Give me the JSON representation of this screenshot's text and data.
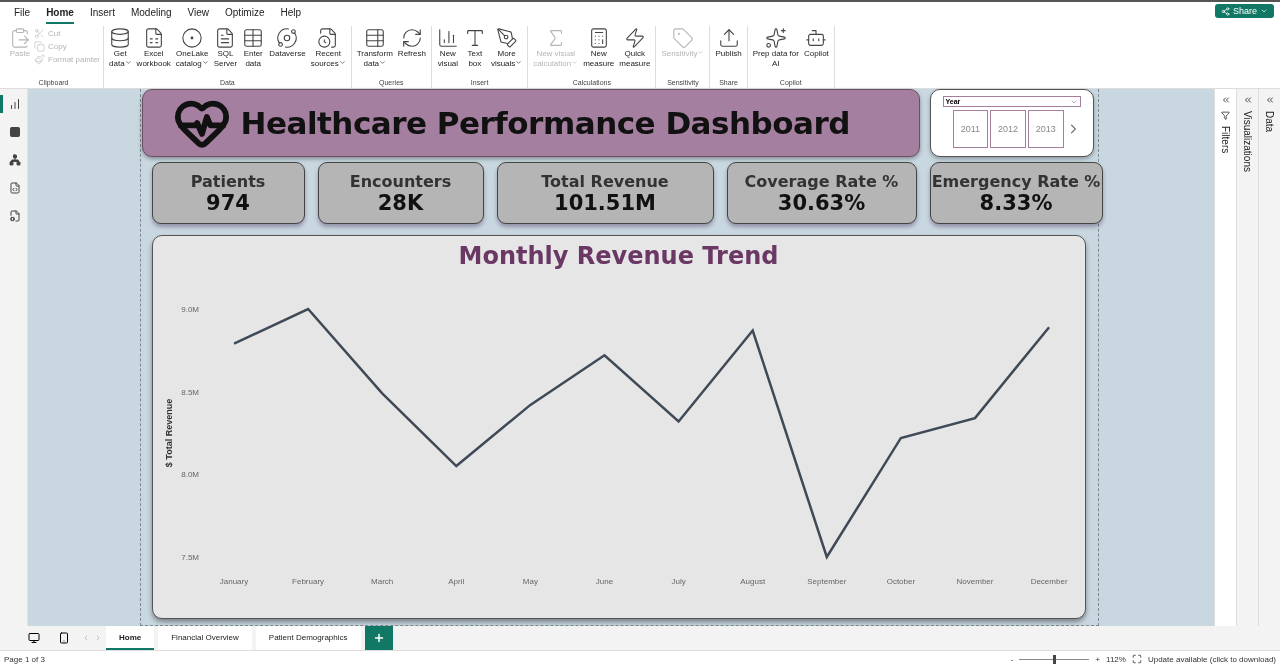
{
  "menu": [
    {
      "label": "File",
      "selected": false
    },
    {
      "label": "Home",
      "selected": true
    },
    {
      "label": "Insert",
      "selected": false
    },
    {
      "label": "Modeling",
      "selected": false
    },
    {
      "label": "View",
      "selected": false
    },
    {
      "label": "Optimize",
      "selected": false
    },
    {
      "label": "Help",
      "selected": false
    }
  ],
  "share_button": {
    "label": "Share"
  },
  "ribbon": {
    "groups": [
      {
        "name": "Clipboard",
        "items": [
          {
            "label": "Paste",
            "kind": "large",
            "disabled": true,
            "dropdown": false
          },
          {
            "label": "Cut",
            "kind": "small",
            "disabled": true
          },
          {
            "label": "Copy",
            "kind": "small",
            "disabled": true
          },
          {
            "label": "Format painter",
            "kind": "small",
            "disabled": true
          }
        ]
      },
      {
        "name": "Data",
        "items": [
          {
            "label": "Get\ndata",
            "kind": "large",
            "disabled": false,
            "dropdown": true
          },
          {
            "label": "Excel\nworkbook",
            "kind": "large",
            "disabled": false,
            "dropdown": false
          },
          {
            "label": "OneLake\ncatalog",
            "kind": "large",
            "disabled": false,
            "dropdown": true
          },
          {
            "label": "SQL\nServer",
            "kind": "large",
            "disabled": false,
            "dropdown": false
          },
          {
            "label": "Enter\ndata",
            "kind": "large",
            "disabled": false,
            "dropdown": false
          },
          {
            "label": "Dataverse",
            "kind": "large",
            "disabled": false,
            "dropdown": false
          },
          {
            "label": "Recent\nsources",
            "kind": "large",
            "disabled": false,
            "dropdown": true
          }
        ]
      },
      {
        "name": "Queries",
        "items": [
          {
            "label": "Transform\ndata",
            "kind": "large",
            "disabled": false,
            "dropdown": true
          },
          {
            "label": "Refresh",
            "kind": "large",
            "disabled": false,
            "dropdown": false
          }
        ]
      },
      {
        "name": "Insert",
        "items": [
          {
            "label": "New\nvisual",
            "kind": "large",
            "disabled": false,
            "dropdown": false
          },
          {
            "label": "Text\nbox",
            "kind": "large",
            "disabled": false,
            "dropdown": false
          },
          {
            "label": "More\nvisuals",
            "kind": "large",
            "disabled": false,
            "dropdown": true
          }
        ]
      },
      {
        "name": "Calculations",
        "items": [
          {
            "label": "New visual\ncalculation",
            "kind": "large",
            "disabled": true,
            "dropdown": true
          },
          {
            "label": "New\nmeasure",
            "kind": "large",
            "disabled": false,
            "dropdown": false
          },
          {
            "label": "Quick\nmeasure",
            "kind": "large",
            "disabled": false,
            "dropdown": false
          }
        ]
      },
      {
        "name": "Sensitivity",
        "items": [
          {
            "label": "Sensitivity",
            "kind": "large",
            "disabled": true,
            "dropdown": true
          }
        ]
      },
      {
        "name": "Share",
        "items": [
          {
            "label": "Publish",
            "kind": "large",
            "disabled": false,
            "dropdown": false
          }
        ]
      },
      {
        "name": "Copilot",
        "items": [
          {
            "label": "Prep data for\nAI",
            "kind": "large",
            "disabled": false,
            "dropdown": false
          },
          {
            "label": "Copilot",
            "kind": "large",
            "disabled": false,
            "dropdown": false
          }
        ]
      }
    ]
  },
  "views": [
    {
      "selected": true
    },
    {
      "selected": false
    },
    {
      "selected": false
    },
    {
      "selected": false
    },
    {
      "selected": false
    }
  ],
  "panes": [
    {
      "label": "Filters",
      "selected": true
    },
    {
      "label": "Visualizations",
      "selected": false
    },
    {
      "label": "Data",
      "selected": false
    }
  ],
  "dashboard": {
    "title": "Healthcare Performance Dashboard",
    "slicer": {
      "title": "Year",
      "tiles": [
        {
          "label": "2011",
          "selected": false
        },
        {
          "label": "2012",
          "selected": false
        },
        {
          "label": "2013",
          "selected": false
        }
      ]
    },
    "kpis": [
      {
        "label": "Patients",
        "value": "974"
      },
      {
        "label": "Encounters",
        "value": "28K"
      },
      {
        "label": "Total Revenue",
        "value": "101.51M"
      },
      {
        "label": "Coverage Rate %",
        "value": "30.63%"
      },
      {
        "label": "Emergency Rate %",
        "value": "8.33%"
      }
    ],
    "chart_data": {
      "type": "line",
      "title": "Monthly Revenue Trend",
      "ylabel": "$ Total Revenue",
      "categories": [
        "January",
        "February",
        "March",
        "April",
        "May",
        "June",
        "July",
        "August",
        "September",
        "October",
        "November",
        "December"
      ],
      "series": [
        {
          "color": "#3f4a56",
          "values": [
            8.79,
            9.0,
            8.49,
            8.05,
            8.42,
            8.72,
            8.32,
            8.87,
            7.5,
            8.22,
            8.34,
            8.89
          ]
        }
      ],
      "ylim": [
        7.5,
        9.0
      ],
      "yticks": [
        {
          "value": 7.5,
          "label": "7.5M"
        },
        {
          "value": 8.0,
          "label": "8.0M"
        },
        {
          "value": 8.5,
          "label": "8.5M"
        },
        {
          "value": 9.0,
          "label": "9.0M"
        }
      ]
    }
  },
  "page_tabs": [
    {
      "label": "Home",
      "selected": true
    },
    {
      "label": "Financial Overview",
      "selected": false
    },
    {
      "label": "Patient Demographics",
      "selected": false
    }
  ],
  "status": {
    "page": "Page 1 of 3",
    "zoom_minus": "-",
    "zoom_plus": "+",
    "zoom": {
      "level": 0.48,
      "reading": "112%"
    },
    "update": "Update available (click to download)"
  }
}
